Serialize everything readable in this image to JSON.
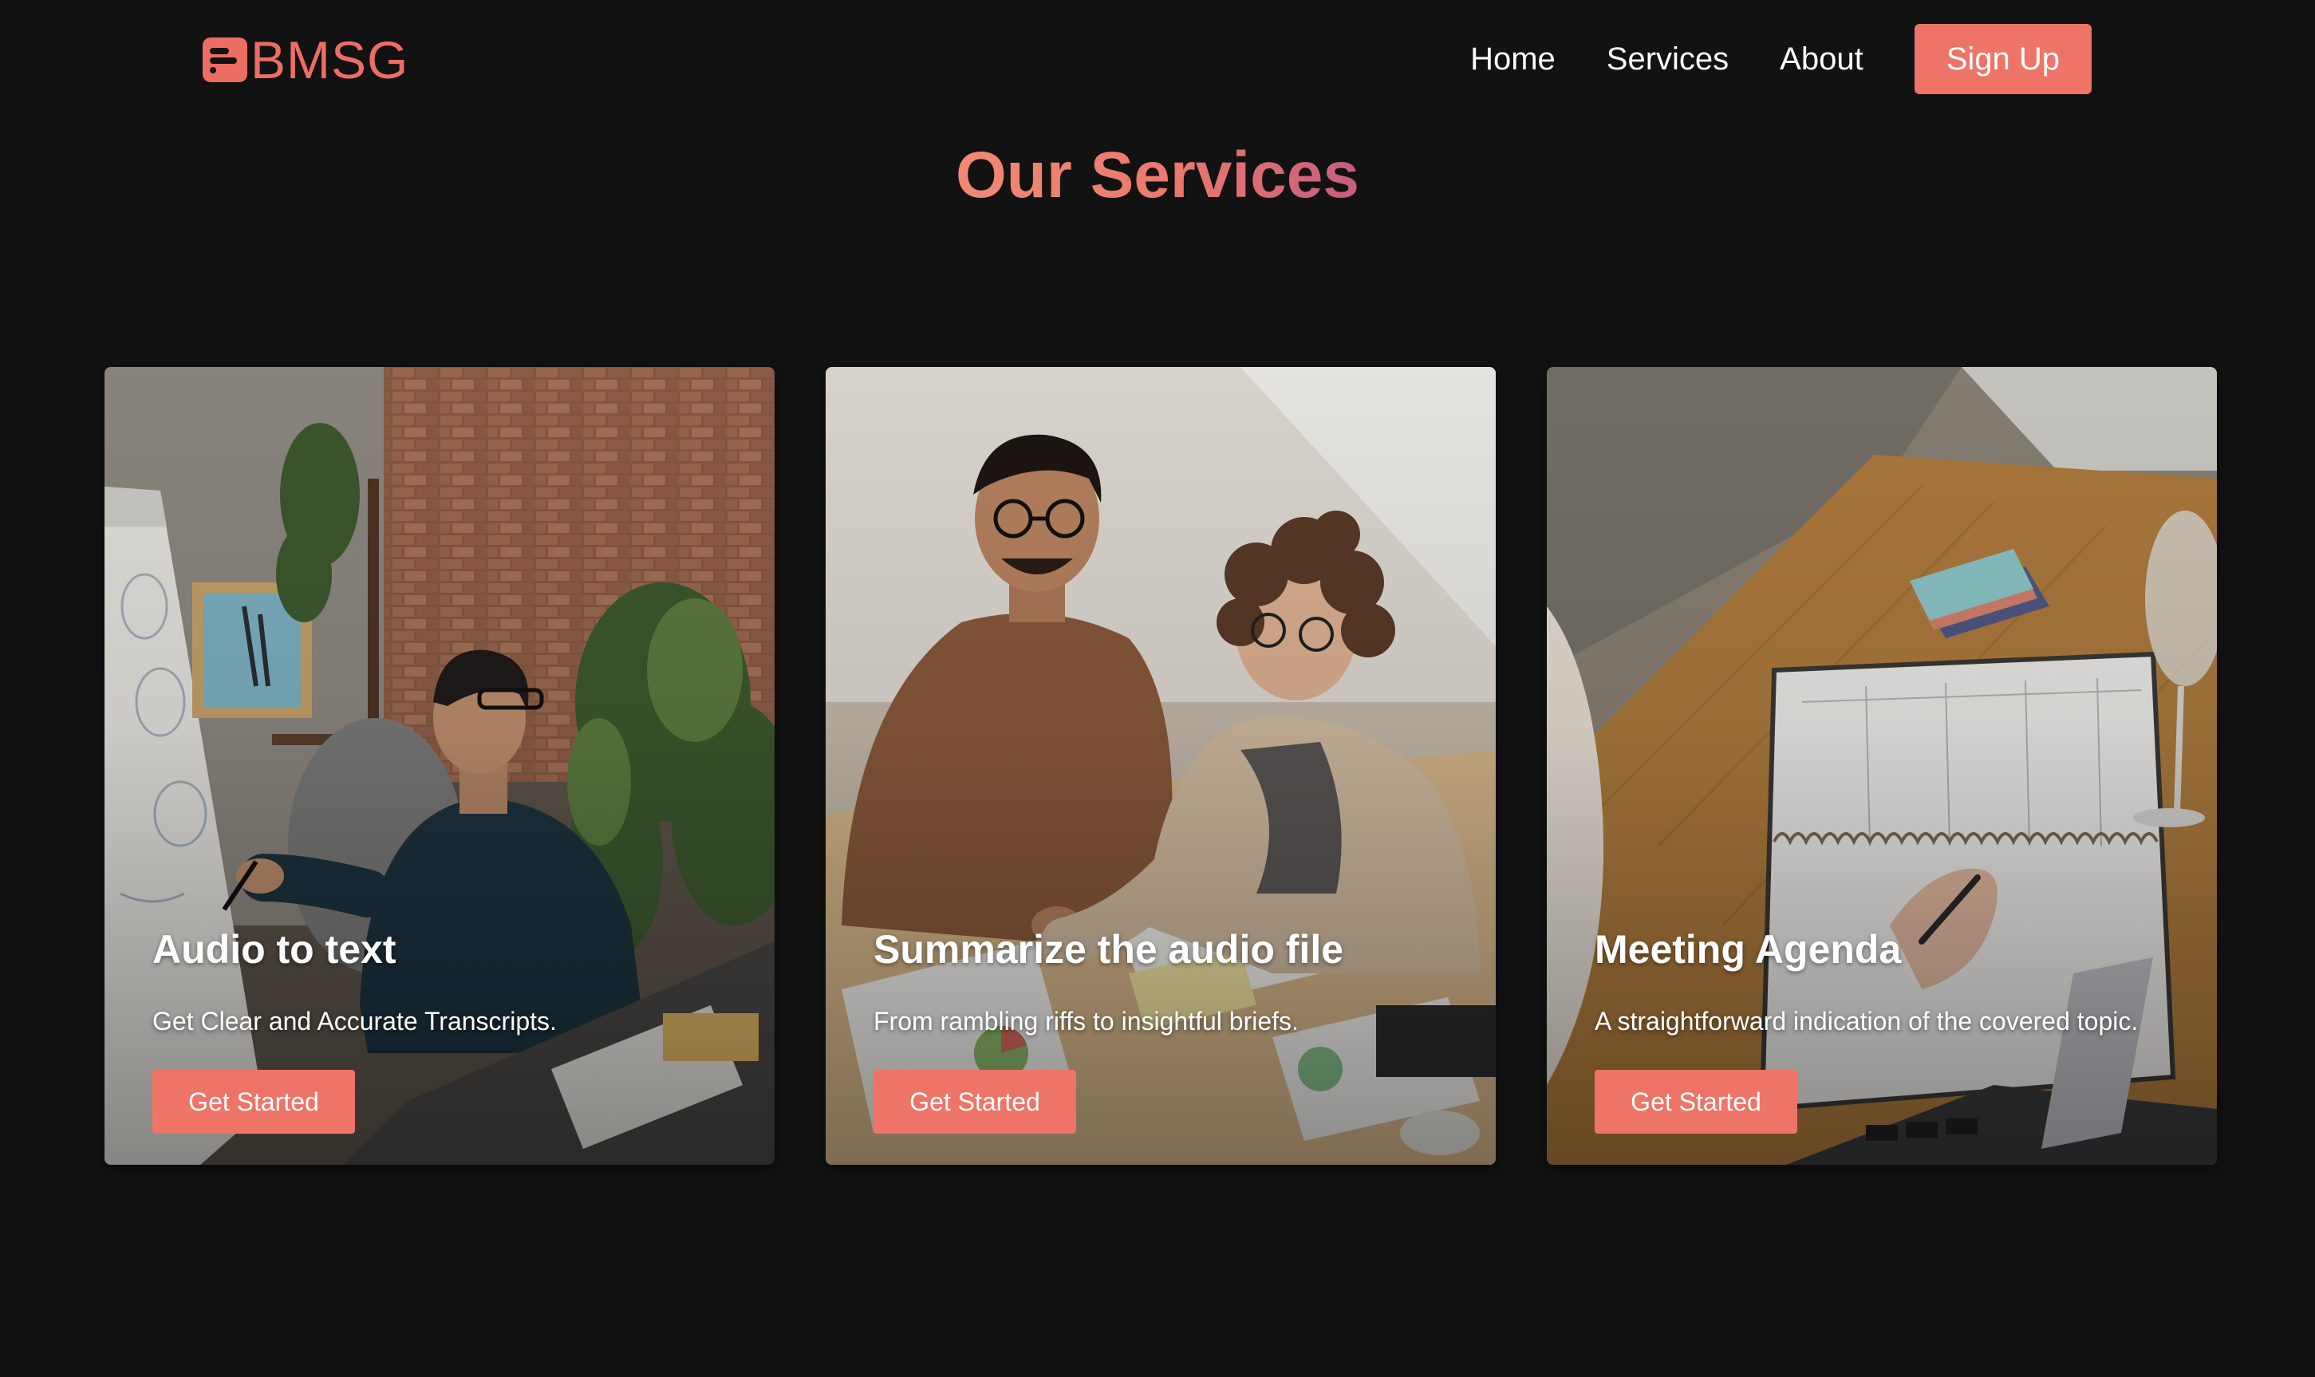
{
  "header": {
    "logo_icon": "document-list-icon",
    "logo_text": "BMSG",
    "nav": {
      "home": "Home",
      "services": "Services",
      "about": "About"
    },
    "signup_label": "Sign Up"
  },
  "main": {
    "title": "Our Services",
    "cards": [
      {
        "title": "Audio to text",
        "description": "Get Clear and Accurate Transcripts.",
        "button_label": "Get Started",
        "image": "man-at-whiteboard-photo"
      },
      {
        "title": "Summarize the audio file",
        "description": "From rambling riffs to insightful briefs.",
        "button_label": "Get Started",
        "image": "two-colleagues-reviewing-charts-photo"
      },
      {
        "title": "Meeting Agenda",
        "description": "A straightforward indication of the covered topic.",
        "button_label": "Get Started",
        "image": "hand-writing-in-planner-photo"
      }
    ]
  },
  "colors": {
    "background": "#121212",
    "accent": "#ee7468",
    "title_gradient_start": "#f08a74",
    "title_gradient_end": "#c65d7e",
    "text": "#ffffff"
  }
}
